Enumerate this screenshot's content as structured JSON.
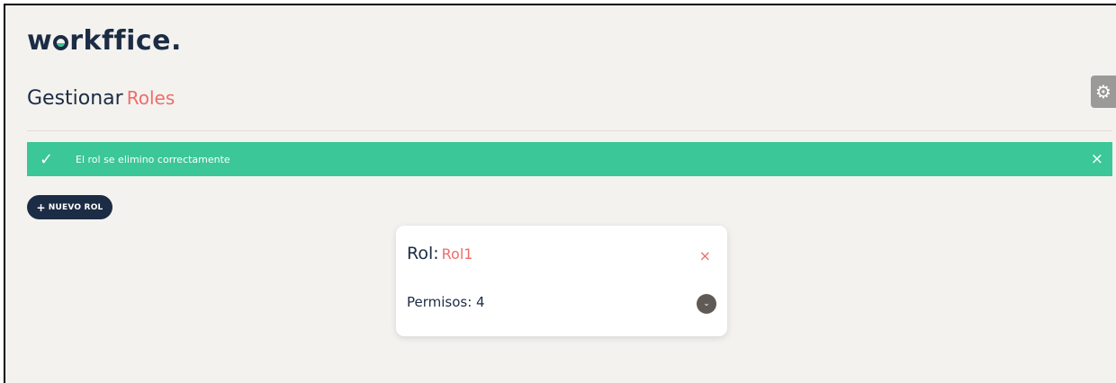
{
  "logo": {
    "part1": "w",
    "part2": "rkffice."
  },
  "header": {
    "title_main": "Gestionar",
    "title_accent": "Roles"
  },
  "alert": {
    "message": "El rol se elimino correctamente",
    "check_glyph": "✓",
    "close_glyph": "×"
  },
  "actions": {
    "new_role_label": "NUEVO ROL",
    "plus_glyph": "+"
  },
  "role_card": {
    "role_label": "Rol:",
    "role_name": "Rol1",
    "delete_glyph": "×",
    "permissions_label": "Permisos: 4",
    "expand_glyph": "⌄"
  },
  "settings": {
    "gear_glyph": "⚙"
  },
  "colors": {
    "brand_dark": "#1c2c44",
    "accent_red": "#ec6e6b",
    "success_green": "#3bc797"
  }
}
